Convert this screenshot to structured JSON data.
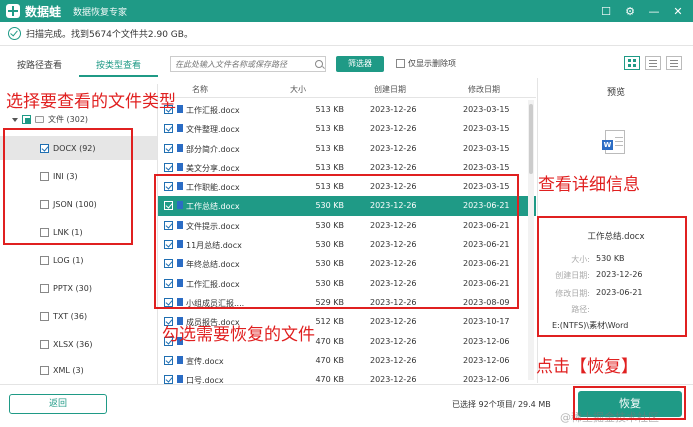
{
  "titlebar": {
    "app_name": "数据蛙",
    "subtitle": "数据恢复专家",
    "controls": [
      "☐",
      "⚙",
      "—",
      "✕"
    ]
  },
  "status": {
    "text": "扫描完成。找到5674个文件共2.90 GB。"
  },
  "tabs": [
    {
      "label": "按路径查看",
      "active": false
    },
    {
      "label": "按类型查看",
      "active": true
    }
  ],
  "toolbar": {
    "search_placeholder": "在此处输入文件名称或保存路径",
    "filter_label": "筛选器",
    "only_deleted_label": "仅显示删除项"
  },
  "tree": {
    "group_label": "文件 (302)",
    "items": [
      {
        "label": "DOCX (92)",
        "checked": true,
        "selected": true
      },
      {
        "label": "INI (3)",
        "checked": false
      },
      {
        "label": "JSON (100)",
        "checked": false
      },
      {
        "label": "LNK (1)",
        "checked": false
      },
      {
        "label": "LOG (1)",
        "checked": false
      },
      {
        "label": "PPTX (30)",
        "checked": false
      },
      {
        "label": "TXT (36)",
        "checked": false
      },
      {
        "label": "XLSX (36)",
        "checked": false
      },
      {
        "label": "XML (3)",
        "checked": false
      }
    ]
  },
  "table": {
    "columns": {
      "name": "名称",
      "size": "大小",
      "created": "创建日期",
      "modified": "修改日期"
    },
    "rows": [
      {
        "name": "工作汇报.docx",
        "size": "513 KB",
        "created": "2023-12-26",
        "modified": "2023-03-15"
      },
      {
        "name": "文件整理.docx",
        "size": "513 KB",
        "created": "2023-12-26",
        "modified": "2023-03-15"
      },
      {
        "name": "部分简介.docx",
        "size": "513 KB",
        "created": "2023-12-26",
        "modified": "2023-03-15"
      },
      {
        "name": "美文分享.docx",
        "size": "513 KB",
        "created": "2023-12-26",
        "modified": "2023-03-15"
      },
      {
        "name": "工作职能.docx",
        "size": "513 KB",
        "created": "2023-12-26",
        "modified": "2023-03-15"
      },
      {
        "name": "工作总结.docx",
        "size": "530 KB",
        "created": "2023-12-26",
        "modified": "2023-06-21",
        "selected": true
      },
      {
        "name": "文件提示.docx",
        "size": "530 KB",
        "created": "2023-12-26",
        "modified": "2023-06-21"
      },
      {
        "name": "11月总结.docx",
        "size": "530 KB",
        "created": "2023-12-26",
        "modified": "2023-06-21"
      },
      {
        "name": "年终总结.docx",
        "size": "530 KB",
        "created": "2023-12-26",
        "modified": "2023-06-21"
      },
      {
        "name": "工作汇报.docx",
        "size": "530 KB",
        "created": "2023-12-26",
        "modified": "2023-06-21"
      },
      {
        "name": "小组成员汇报....",
        "size": "529 KB",
        "created": "2023-12-26",
        "modified": "2023-08-09"
      },
      {
        "name": "成员报告.docx",
        "size": "512 KB",
        "created": "2023-12-26",
        "modified": "2023-10-17"
      },
      {
        "name": "",
        "size": "470 KB",
        "created": "2023-12-26",
        "modified": "2023-12-06"
      },
      {
        "name": "宣传.docx",
        "size": "470 KB",
        "created": "2023-12-26",
        "modified": "2023-12-06"
      },
      {
        "name": "口号.docx",
        "size": "470 KB",
        "created": "2023-12-26",
        "modified": "2023-12-06"
      }
    ]
  },
  "preview": {
    "title": "预览",
    "file_name": "工作总结.docx",
    "labels": {
      "size": "大小:",
      "created": "创建日期:",
      "modified": "修改日期:",
      "path": "路径:"
    },
    "size": "530 KB",
    "created": "2023-12-26",
    "modified": "2023-06-21",
    "path": "E:(NTFS)\\素材\\Word"
  },
  "bottom": {
    "back_label": "返回",
    "selected_info": "已选择 92个项目/ 29.4 MB",
    "recover_label": "恢复",
    "watermark": "@稀土掘金技术社区"
  },
  "annotations": {
    "select_type": "选择要查看的文件类型",
    "view_details": "查看详细信息",
    "check_files": "勾选需要恢复的文件",
    "click_recover": "点击【恢复】"
  },
  "colors": {
    "brand": "#1f9a86",
    "annotation": "#e02020",
    "file_icon": "#2b6cc4"
  }
}
